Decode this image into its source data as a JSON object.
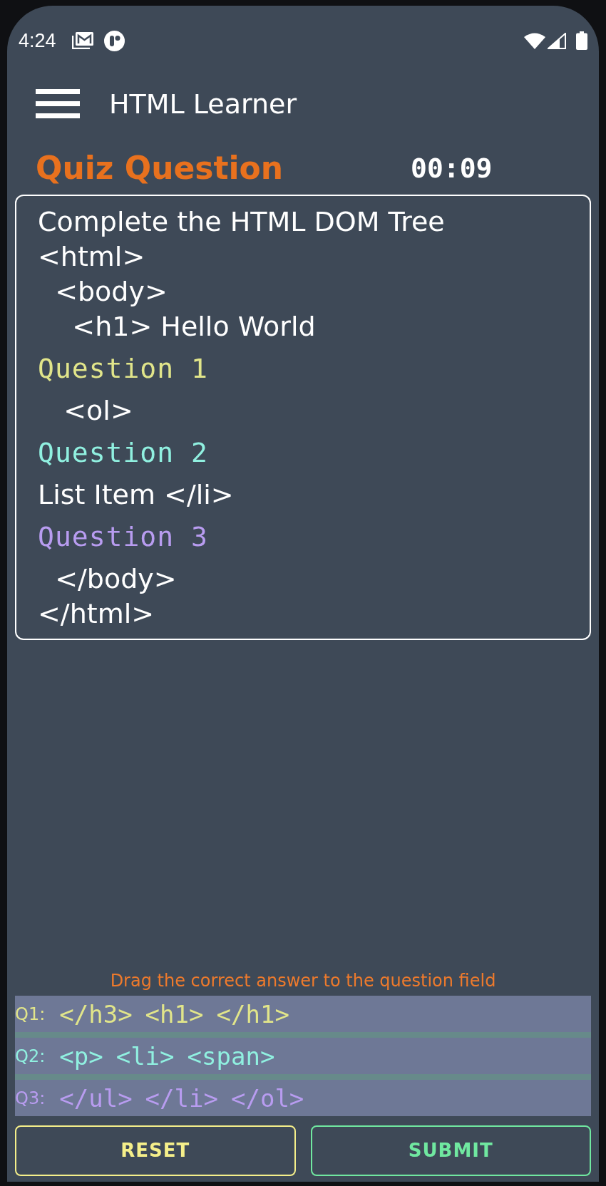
{
  "status_bar": {
    "time": "4:24"
  },
  "app_bar": {
    "title": "HTML Learner"
  },
  "quiz": {
    "title": "Quiz Question",
    "timer": "00:09",
    "prompt": "Complete the HTML DOM Tree",
    "lines": [
      {
        "kind": "code",
        "text": "<html>"
      },
      {
        "kind": "code",
        "text": "  <body>"
      },
      {
        "kind": "code",
        "text": "    <h1> Hello World"
      },
      {
        "kind": "blank",
        "text": "Question 1",
        "color": "#e1e58a"
      },
      {
        "kind": "code",
        "text": "   <ol>"
      },
      {
        "kind": "blank",
        "text": "Question 2",
        "color": "#90f0e0"
      },
      {
        "kind": "code",
        "text": "List Item </li>"
      },
      {
        "kind": "blank",
        "text": "Question 3",
        "color": "#b89cf0"
      },
      {
        "kind": "code",
        "text": "  </body>"
      },
      {
        "kind": "code",
        "text": "</html>"
      }
    ]
  },
  "answers": {
    "instruction": "Drag the correct answer to the question field",
    "rows": [
      {
        "label": "Q1:",
        "color": "#e1e58a",
        "options": [
          "</h3>",
          "<h1>",
          "</h1>"
        ]
      },
      {
        "label": "Q2:",
        "color": "#90f0e0",
        "options": [
          "<p>",
          "<li>",
          "<span>"
        ]
      },
      {
        "label": "Q3:",
        "color": "#b89cf0",
        "options": [
          "</ul>",
          "</li>",
          "</ol>"
        ]
      }
    ]
  },
  "buttons": [
    {
      "label": "RESET",
      "color": "#f5ef8a"
    },
    {
      "label": "SUBMIT",
      "color": "#70e8a0"
    }
  ]
}
